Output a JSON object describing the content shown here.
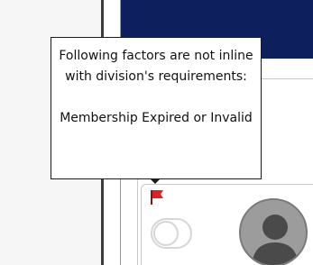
{
  "tooltip": {
    "heading": "Following factors are not inline with division's requirements:",
    "factors": [
      "Membership Expired or Invalid"
    ]
  },
  "card": {
    "flag_icon": "flag-icon",
    "toggle_state": "off",
    "avatar_icon": "user-silhouette-icon"
  },
  "colors": {
    "header": "#0d1f5c",
    "flag": "#e02020",
    "avatar": "#9c9c9c"
  }
}
